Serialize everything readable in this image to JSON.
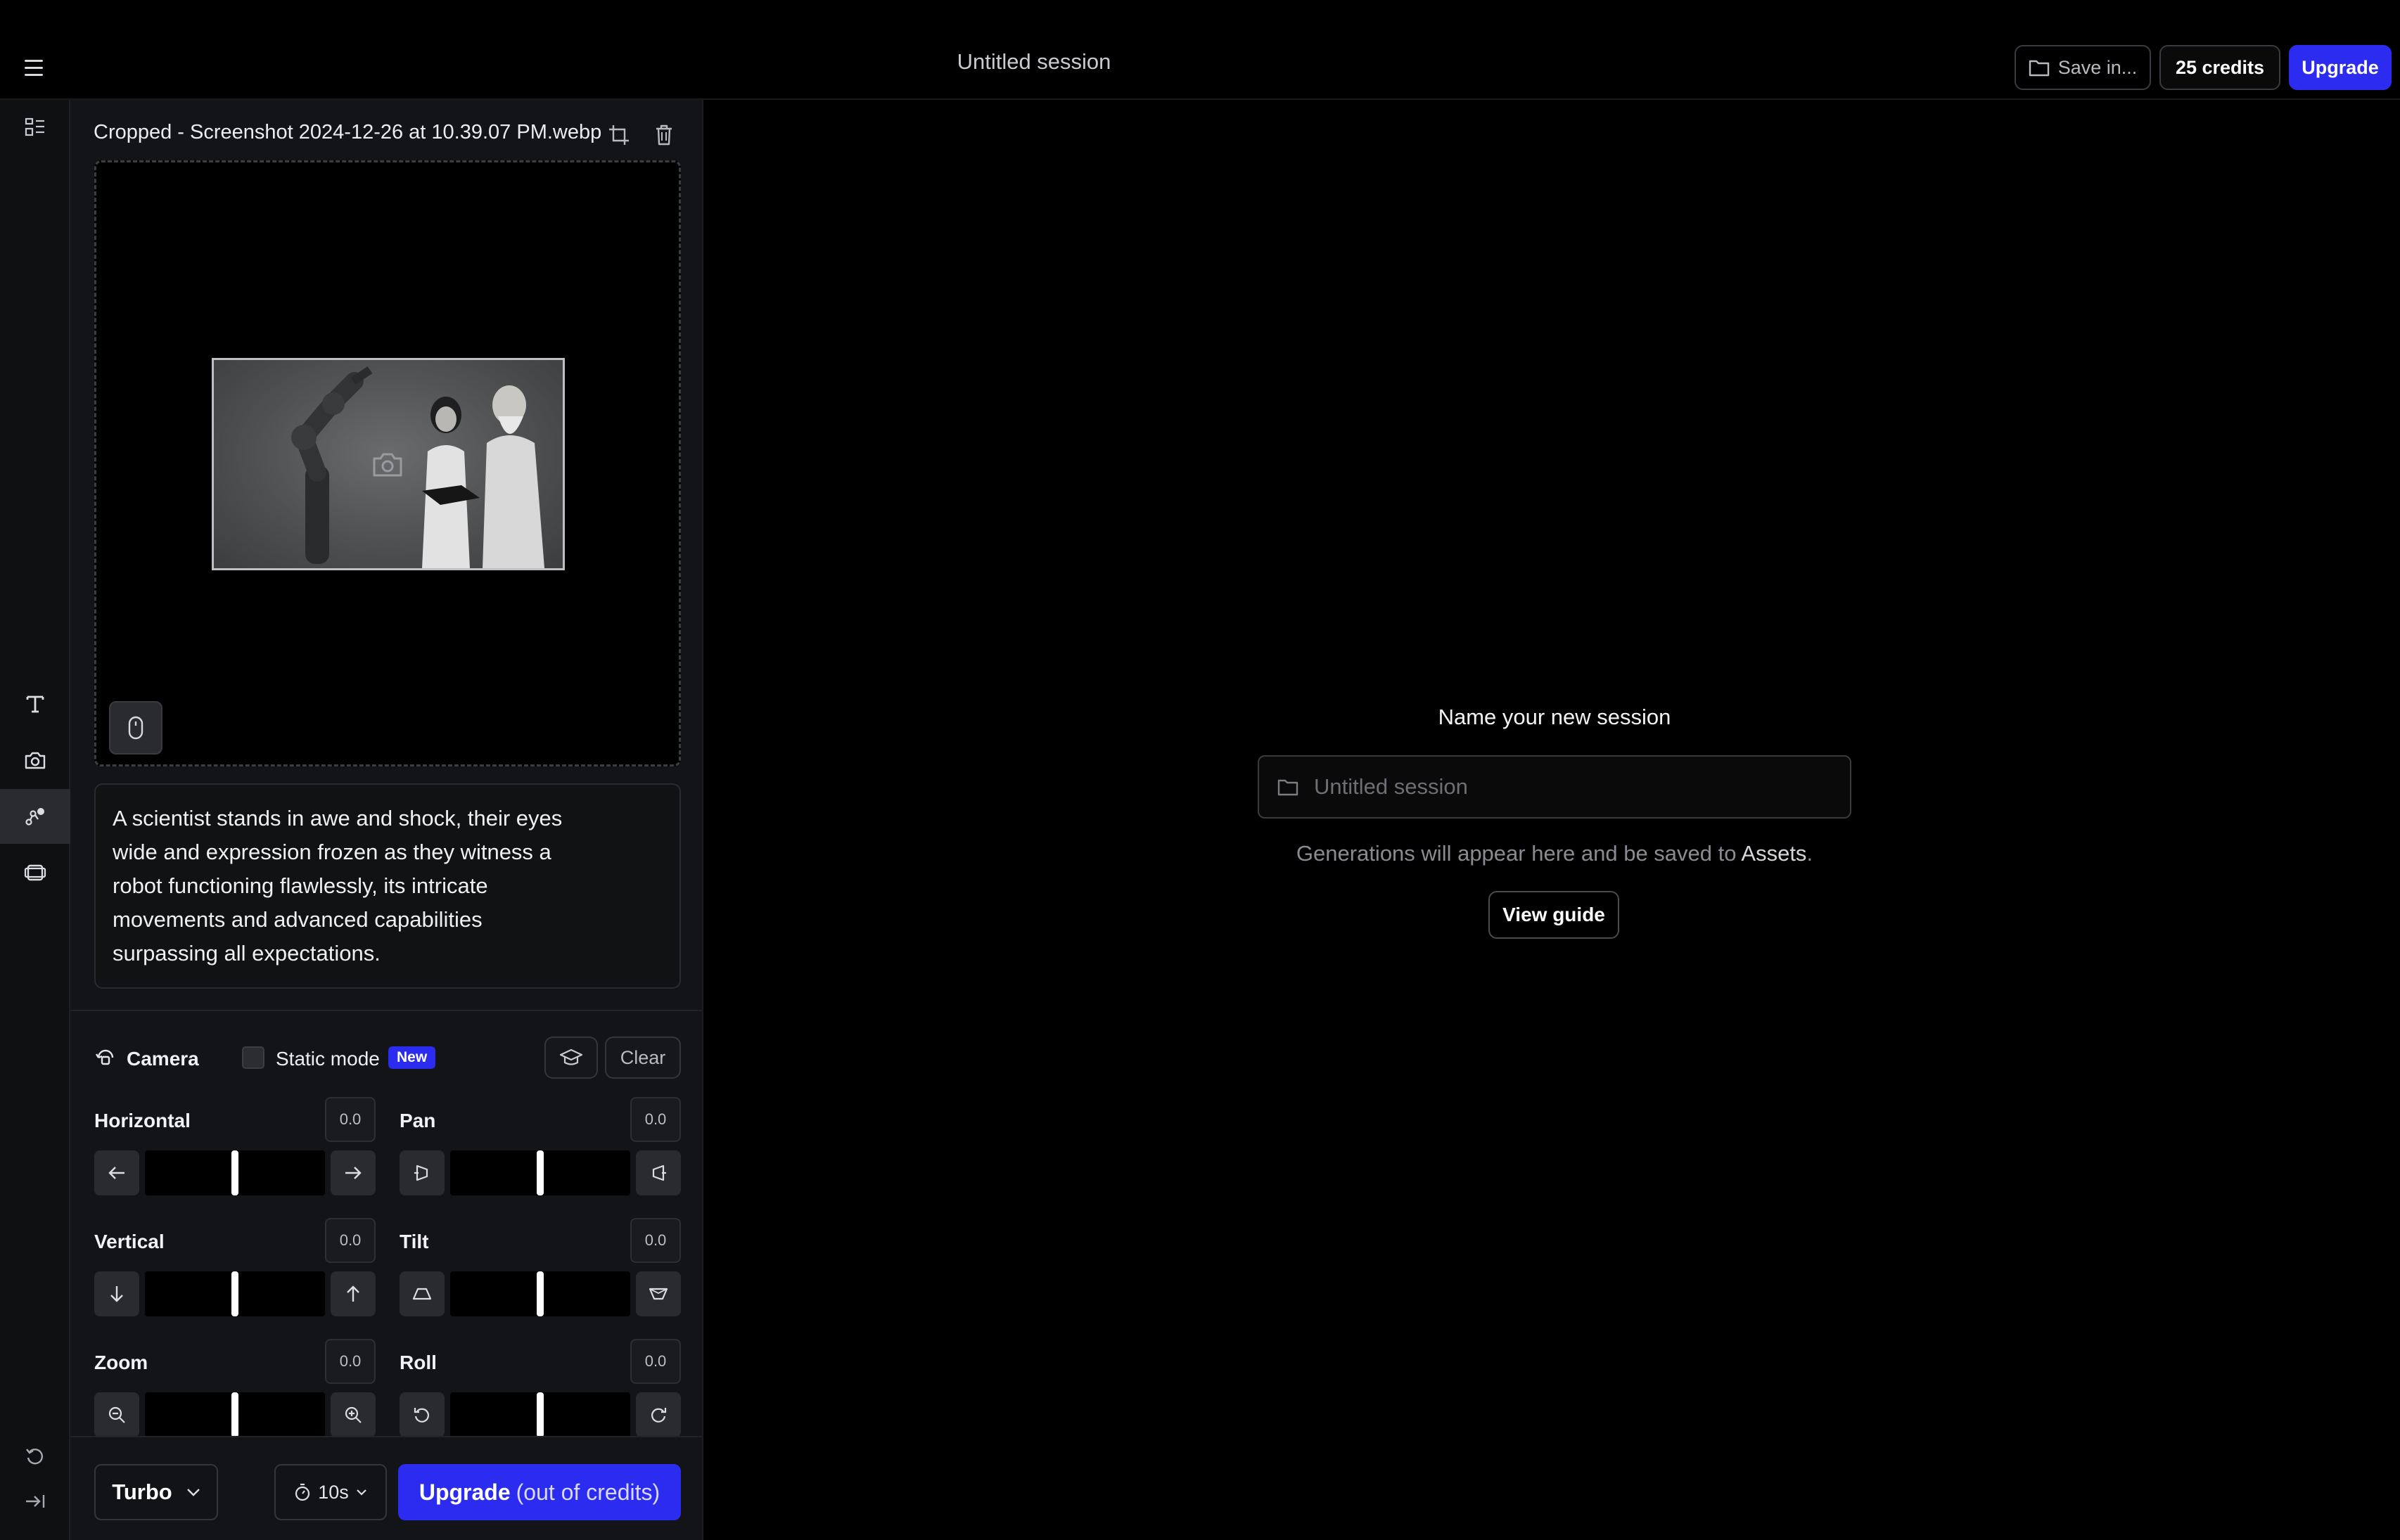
{
  "header": {
    "session_title": "Untitled session",
    "save_label": "Save in...",
    "credits_label": "25 credits",
    "upgrade_label": "Upgrade"
  },
  "rail": {
    "icons": [
      "layout-icon",
      "text-icon",
      "camera-icon",
      "motion-brush-icon",
      "frames-icon",
      "undo-icon",
      "collapse-icon"
    ],
    "active": "motion-brush-icon"
  },
  "panel": {
    "file_name": "Cropped - Screenshot 2024-12-26 at 10.39.07 PM.webp",
    "prompt": "A scientist stands in awe and shock, their eyes wide and expression frozen as they witness a robot functioning flawlessly, its intricate movements and advanced capabilities surpassing all expectations.",
    "camera": {
      "label": "Camera",
      "static_mode_label": "Static mode",
      "new_badge": "New",
      "clear_label": "Clear",
      "controls": {
        "horizontal": {
          "label": "Horizontal",
          "value": "0.0"
        },
        "pan": {
          "label": "Pan",
          "value": "0.0"
        },
        "vertical": {
          "label": "Vertical",
          "value": "0.0"
        },
        "tilt": {
          "label": "Tilt",
          "value": "0.0"
        },
        "zoom": {
          "label": "Zoom",
          "value": "0.0"
        },
        "roll": {
          "label": "Roll",
          "value": "0.0"
        }
      }
    },
    "footer": {
      "model": "Turbo",
      "duration": "10s",
      "generate_main": "Upgrade",
      "generate_sub": "(out of credits)"
    }
  },
  "main": {
    "name_title": "Name your new session",
    "input_placeholder": "Untitled session",
    "info_prefix": "Generations will appear here and be saved to ",
    "info_link": "Assets",
    "info_suffix": ".",
    "view_guide_label": "View guide"
  },
  "colors": {
    "accent": "#2c2cf0",
    "background": "#000000",
    "panel": "#131417"
  }
}
